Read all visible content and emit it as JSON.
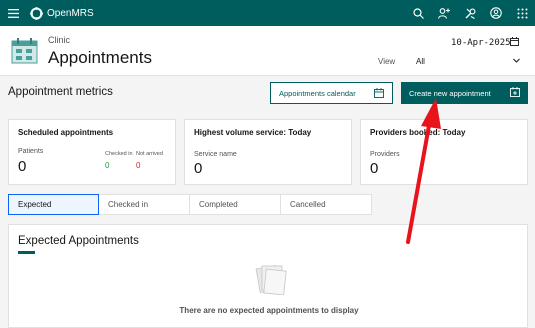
{
  "topbar": {
    "brand": "OpenMRS",
    "icons": [
      "menu-icon",
      "search-icon",
      "add-user-icon",
      "tools-icon",
      "user-avatar-icon",
      "app-switcher-icon"
    ],
    "brand_color": "#005d5d"
  },
  "header": {
    "location": "Clinic",
    "title": "Appointments",
    "date": "10-Apr-2025",
    "view_label": "View",
    "view_selected": "All"
  },
  "metrics": {
    "title": "Appointment metrics",
    "calendar_button": "Appointments calendar",
    "create_button": "Create new appointment",
    "cards": {
      "scheduled": {
        "title": "Scheduled appointments",
        "patients_label": "Patients",
        "patients_value": "0",
        "checked_in_label": "Checked in",
        "checked_in_value": "0",
        "not_arrived_label": "Not arrived",
        "not_arrived_value": "0"
      },
      "highest_volume": {
        "title": "Highest volume service: Today",
        "sub_label": "Service name",
        "value": "0"
      },
      "providers": {
        "title": "Providers booked: Today",
        "sub_label": "Providers",
        "value": "0"
      }
    }
  },
  "tabs": {
    "expected": "Expected",
    "checked_in": "Checked in",
    "completed": "Completed",
    "cancelled": "Cancelled",
    "active": "Expected"
  },
  "panel": {
    "title": "Expected Appointments",
    "empty_message": "There are no expected appointments to display"
  },
  "colors": {
    "accent": "#005d5d",
    "checked_in": "#24a148",
    "not_arrived": "#da1e28",
    "annotation_arrow": "#e8141b"
  }
}
